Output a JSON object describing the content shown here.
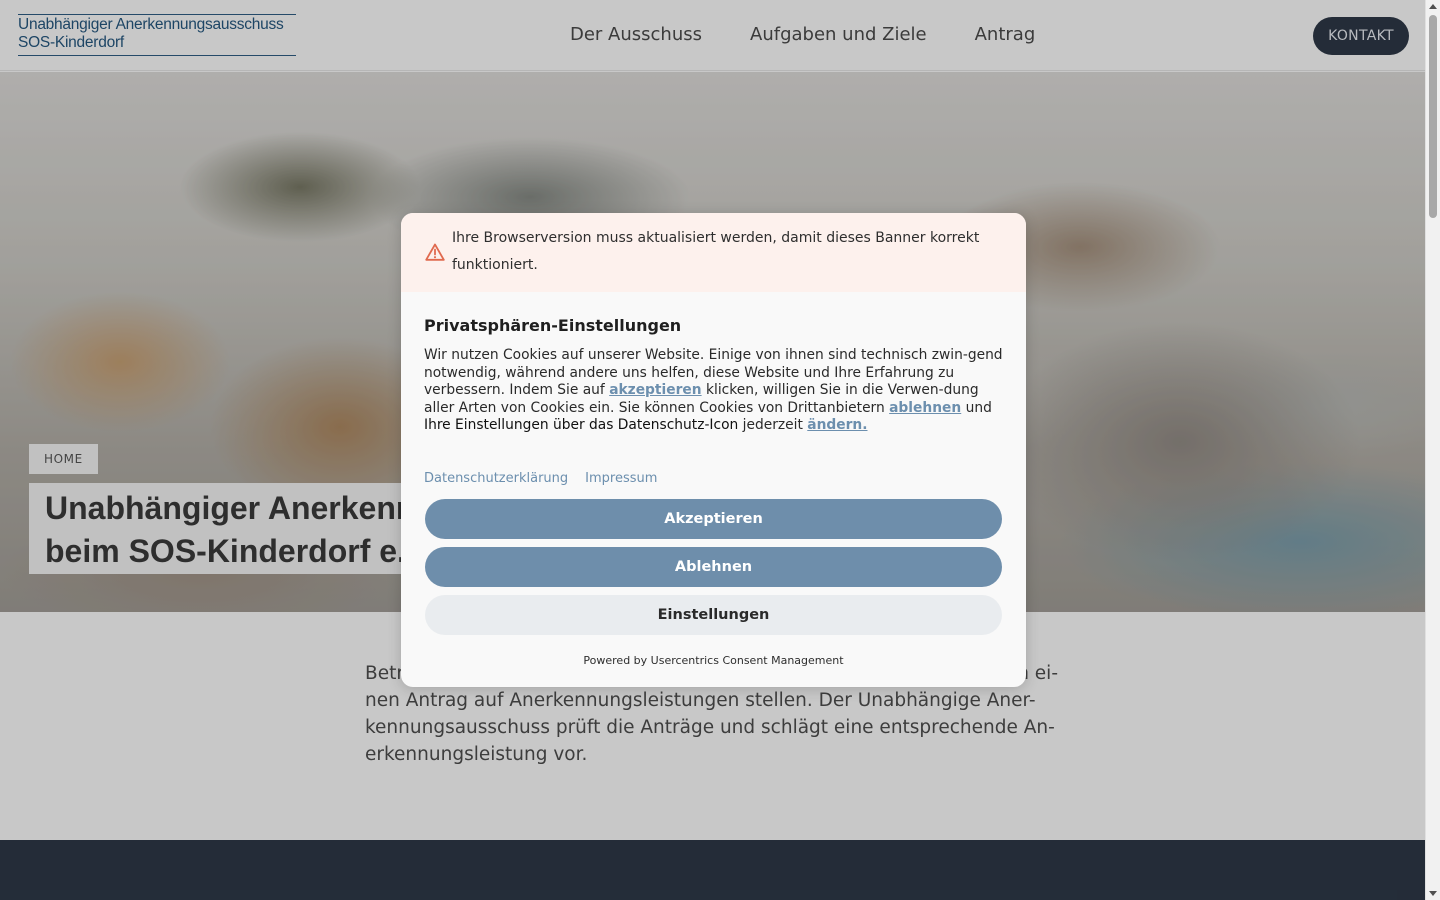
{
  "header": {
    "logo_line1": "Unabhängiger Anerkennungsausschuss",
    "logo_line2": "SOS-Kinderdorf",
    "nav": [
      "Der Ausschuss",
      "Aufgaben und Ziele",
      "Antrag"
    ],
    "contact_button": "KONTAKT"
  },
  "hero": {
    "breadcrumb": "HOME",
    "title_line1": "Unabhängiger Anerkenn",
    "title_line2": "beim SOS-Kinderdorf e."
  },
  "intro": {
    "line1": "Betr",
    "line1_end": "n ei-",
    "line2": "nen Antrag auf Anerkennungsleistungen stellen. Der Unabhängige Aner-",
    "line3": "kennungsausschuss prüft die Anträge und schlägt eine entsprechende An-",
    "line4": "erkennungsleistung vor."
  },
  "consent": {
    "warning": "Ihre Browserversion muss aktualisiert werden, damit dieses Banner korrekt funktioniert.",
    "title": "Privatsphären-Einstellungen",
    "body_1": "Wir nutzen Cookies auf unserer Website. Einige von ihnen sind technisch zwin-gend notwendig, während andere uns helfen, diese Website und Ihre Erfahrung zu verbessern. Indem Sie auf ",
    "link_accept": "akzeptieren",
    "body_2": " klicken, willigen Sie in die Verwen-dung aller Arten von Cookies ein. Sie können Cookies von Drittanbietern ",
    "link_deny": "ablehnen",
    "body_3": " und ",
    "body_strong": "Ihre Einstellungen über das Datenschutz-Icon",
    "body_4": " jederzeit ",
    "link_change": "ändern.",
    "link_privacy": "Datenschutzerklärung",
    "link_imprint": "Impressum",
    "btn_accept": "Akzeptieren",
    "btn_deny": "Ablehnen",
    "btn_settings": "Einstellungen",
    "powered_by": "Powered by Usercentrics Consent Management"
  },
  "colors": {
    "accent": "#6e8eab",
    "dark": "#2d3847",
    "warning_bg": "#fdf1ed",
    "warning_icon": "#e06a4f"
  }
}
